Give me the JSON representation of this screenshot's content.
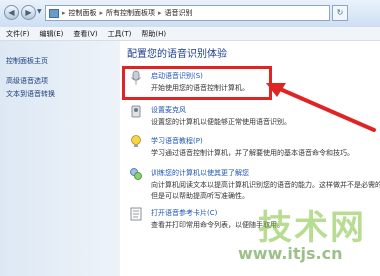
{
  "address_bar": {
    "crumbs": [
      "控制面板",
      "所有控制面板项",
      "语音识别"
    ]
  },
  "menu": [
    "文件(F)",
    "编辑(E)",
    "查看(V)",
    "工具(T)",
    "帮助(H)"
  ],
  "sidebar": {
    "items": [
      {
        "label": "控制面板主页"
      },
      {
        "label": "高级语音选项"
      },
      {
        "label": "文本到语音转换"
      }
    ]
  },
  "main": {
    "heading": "配置您的语音识别体验",
    "tasks": [
      {
        "title": "启动语音识别(S)",
        "desc": [
          "开始使用您的语音控制计算机。"
        ]
      },
      {
        "title": "设置麦克风",
        "desc": [
          "设置您的计算机以便能够正常使用语音识别。"
        ]
      },
      {
        "title": "学习语音教程(P)",
        "desc": [
          "学习通过语音控制计算机，并了解要使用的基本语音命令和技巧。"
        ]
      },
      {
        "title": "训练您的计算机以使其更了解您",
        "desc": [
          "向计算机阅读文本以提高计算机识别您的语音的能力。这样做并不是必需的，",
          "但是可以帮助提高听写准确性。"
        ]
      },
      {
        "title": "打开语音参考卡片(C)",
        "desc": [
          "查看并打印常用命令列表，以便随手取用。"
        ]
      }
    ]
  },
  "watermark": {
    "text": "技术网",
    "url": "www.itjs.cn"
  },
  "colors": {
    "highlight": "#e02424",
    "link": "#1d55b8",
    "heading": "#1a3d8f"
  }
}
